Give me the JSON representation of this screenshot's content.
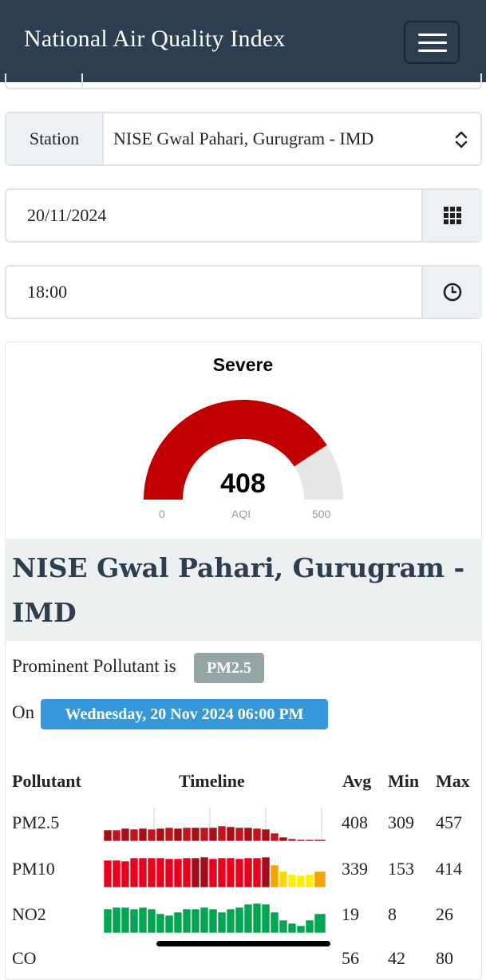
{
  "navbar": {
    "title": "National Air Quality Index"
  },
  "station_field": {
    "label": "Station",
    "value": "NISE Gwal Pahari, Gurugram - IMD"
  },
  "date_field": {
    "value": "20/11/2024"
  },
  "time_field": {
    "value": "18:00"
  },
  "gauge": {
    "category": "Severe",
    "value": 408,
    "min": 0,
    "max": 500,
    "unit": "AQI",
    "colors": {
      "fill": "#c00000",
      "track": "#e6e6e6"
    }
  },
  "station_heading": "NISE Gwal Pahari, Gurugram - IMD",
  "prominent": {
    "prefix": "Prominent Pollutant is",
    "pollutant": "PM2.5"
  },
  "timestamp": {
    "prefix": "On",
    "value": "Wednesday, 20 Nov 2024 06:00 PM"
  },
  "table": {
    "headers": [
      "Pollutant",
      "Timeline",
      "Avg",
      "Min",
      "Max"
    ],
    "rows": [
      {
        "name": "PM2.5",
        "avg": "408",
        "min": "309",
        "max": "457"
      },
      {
        "name": "PM10",
        "avg": "339",
        "min": "153",
        "max": "414"
      },
      {
        "name": "NO2",
        "avg": "19",
        "min": "8",
        "max": "26"
      },
      {
        "name": "CO",
        "avg": "56",
        "min": "42",
        "max": "80"
      }
    ]
  },
  "colors": {
    "navbar": "#2c3e50",
    "badge_grey": "#95a5a6",
    "badge_blue": "#3498db",
    "heading": "#2c3e50"
  }
}
